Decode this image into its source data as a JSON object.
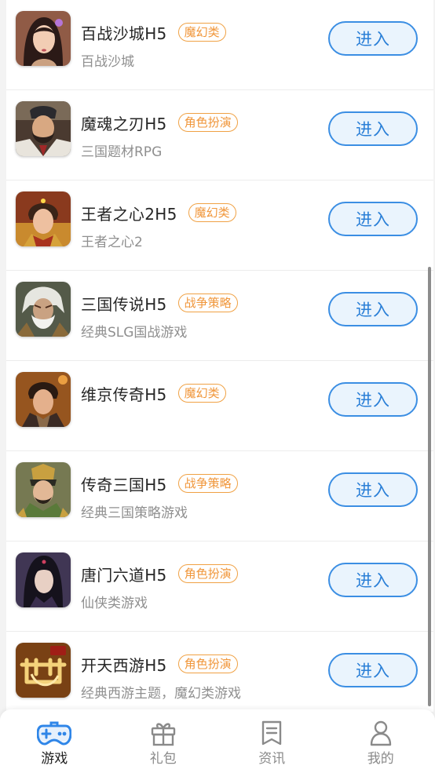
{
  "games": [
    {
      "name": "百战沙城H5",
      "tag": "魔幻类",
      "desc": "百战沙城",
      "button": "进入",
      "icon": "bzsc-icon"
    },
    {
      "name": "魔魂之刃H5",
      "tag": "角色扮演",
      "desc": "三国题材RPG",
      "button": "进入",
      "icon": "mhzr-icon"
    },
    {
      "name": "王者之心2H5",
      "tag": "魔幻类",
      "desc": "王者之心2",
      "button": "进入",
      "icon": "wzzx-icon"
    },
    {
      "name": "三国传说H5",
      "tag": "战争策略",
      "desc": "经典SLG国战游戏",
      "button": "进入",
      "icon": "sgcs-icon"
    },
    {
      "name": "维京传奇H5",
      "tag": "魔幻类",
      "desc": "",
      "button": "进入",
      "icon": "wjcq-icon"
    },
    {
      "name": "传奇三国H5",
      "tag": "战争策略",
      "desc": "经典三国策略游戏",
      "button": "进入",
      "icon": "cqsg-icon"
    },
    {
      "name": "唐门六道H5",
      "tag": "角色扮演",
      "desc": "仙侠类游戏",
      "button": "进入",
      "icon": "tmld-icon"
    },
    {
      "name": "开天西游H5",
      "tag": "角色扮演",
      "desc": "经典西游主题，魔幻类游戏",
      "button": "进入",
      "icon": "ktxy-icon"
    }
  ],
  "nav": {
    "items": [
      {
        "label": "游戏",
        "icon": "gamepad-icon",
        "active": true
      },
      {
        "label": "礼包",
        "icon": "gift-icon",
        "active": false
      },
      {
        "label": "资讯",
        "icon": "news-icon",
        "active": false
      },
      {
        "label": "我的",
        "icon": "user-icon",
        "active": false
      }
    ],
    "active_color": "#2f86e8"
  },
  "colors": {
    "tag_orange": "#f0963a",
    "button_blue": "#3b8ee3",
    "button_bg": "#eaf4fd"
  }
}
